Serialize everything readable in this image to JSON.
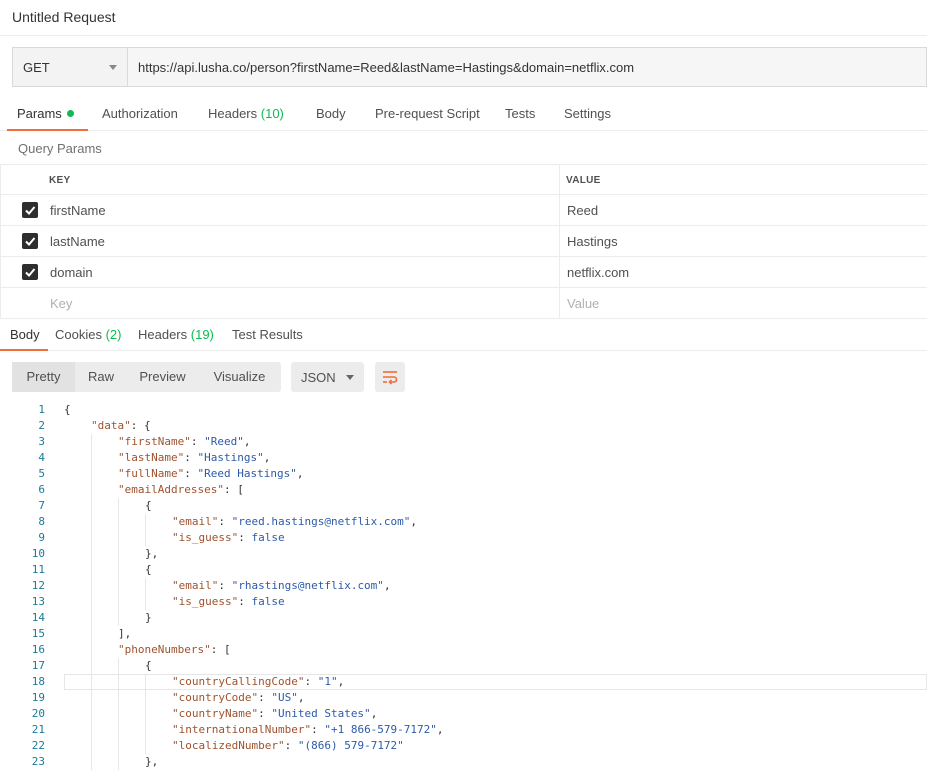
{
  "request": {
    "title": "Untitled Request",
    "method": "GET",
    "url": "https://api.lusha.co/person?firstName=Reed&lastName=Hastings&domain=netflix.com"
  },
  "request_tabs": [
    {
      "label": "Params",
      "count": "",
      "dot": true,
      "active": true
    },
    {
      "label": "Authorization",
      "count": "",
      "dot": false,
      "active": false
    },
    {
      "label": "Headers",
      "count": "(10)",
      "dot": false,
      "active": false
    },
    {
      "label": "Body",
      "count": "",
      "dot": false,
      "active": false
    },
    {
      "label": "Pre-request Script",
      "count": "",
      "dot": false,
      "active": false
    },
    {
      "label": "Tests",
      "count": "",
      "dot": false,
      "active": false
    },
    {
      "label": "Settings",
      "count": "",
      "dot": false,
      "active": false
    }
  ],
  "query_params": {
    "section_label": "Query Params",
    "key_header": "KEY",
    "value_header": "VALUE",
    "rows": [
      {
        "key": "firstName",
        "value": "Reed",
        "checked": true
      },
      {
        "key": "lastName",
        "value": "Hastings",
        "checked": true
      },
      {
        "key": "domain",
        "value": "netflix.com",
        "checked": true
      }
    ],
    "key_placeholder": "Key",
    "value_placeholder": "Value"
  },
  "response_tabs": [
    {
      "label": "Body",
      "count": "",
      "active": true
    },
    {
      "label": "Cookies",
      "count": "(2)",
      "active": false
    },
    {
      "label": "Headers",
      "count": "(19)",
      "active": false
    },
    {
      "label": "Test Results",
      "count": "",
      "active": false
    }
  ],
  "view_modes": [
    "Pretty",
    "Raw",
    "Preview",
    "Visualize"
  ],
  "active_view_mode": "Pretty",
  "format": "JSON",
  "colors": {
    "accent": "#f26b3a",
    "success": "#0cbb52",
    "link_blue": "#2e5aa8",
    "json_key": "#a0522d"
  },
  "code_lines": [
    {
      "n": "1",
      "indent": 0,
      "parts": [
        [
          "p",
          "{"
        ]
      ]
    },
    {
      "n": "2",
      "indent": 1,
      "parts": [
        [
          "k",
          "\"data\""
        ],
        [
          "p",
          ": {"
        ]
      ]
    },
    {
      "n": "3",
      "indent": 2,
      "parts": [
        [
          "k",
          "\"firstName\""
        ],
        [
          "p",
          ": "
        ],
        [
          "s",
          "\"Reed\""
        ],
        [
          "p",
          ","
        ]
      ]
    },
    {
      "n": "4",
      "indent": 2,
      "parts": [
        [
          "k",
          "\"lastName\""
        ],
        [
          "p",
          ": "
        ],
        [
          "s",
          "\"Hastings\""
        ],
        [
          "p",
          ","
        ]
      ]
    },
    {
      "n": "5",
      "indent": 2,
      "parts": [
        [
          "k",
          "\"fullName\""
        ],
        [
          "p",
          ": "
        ],
        [
          "s",
          "\"Reed Hastings\""
        ],
        [
          "p",
          ","
        ]
      ]
    },
    {
      "n": "6",
      "indent": 2,
      "parts": [
        [
          "k",
          "\"emailAddresses\""
        ],
        [
          "p",
          ": ["
        ]
      ]
    },
    {
      "n": "7",
      "indent": 3,
      "parts": [
        [
          "p",
          "{"
        ]
      ]
    },
    {
      "n": "8",
      "indent": 4,
      "parts": [
        [
          "k",
          "\"email\""
        ],
        [
          "p",
          ": "
        ],
        [
          "s",
          "\"reed.hastings@netflix.com\""
        ],
        [
          "p",
          ","
        ]
      ]
    },
    {
      "n": "9",
      "indent": 4,
      "parts": [
        [
          "k",
          "\"is_guess\""
        ],
        [
          "p",
          ": "
        ],
        [
          "s",
          "false"
        ]
      ]
    },
    {
      "n": "10",
      "indent": 3,
      "parts": [
        [
          "p",
          "},"
        ]
      ]
    },
    {
      "n": "11",
      "indent": 3,
      "parts": [
        [
          "p",
          "{"
        ]
      ]
    },
    {
      "n": "12",
      "indent": 4,
      "parts": [
        [
          "k",
          "\"email\""
        ],
        [
          "p",
          ": "
        ],
        [
          "s",
          "\"rhastings@netflix.com\""
        ],
        [
          "p",
          ","
        ]
      ]
    },
    {
      "n": "13",
      "indent": 4,
      "parts": [
        [
          "k",
          "\"is_guess\""
        ],
        [
          "p",
          ": "
        ],
        [
          "s",
          "false"
        ]
      ]
    },
    {
      "n": "14",
      "indent": 3,
      "parts": [
        [
          "p",
          "}"
        ]
      ]
    },
    {
      "n": "15",
      "indent": 2,
      "parts": [
        [
          "p",
          "],"
        ]
      ]
    },
    {
      "n": "16",
      "indent": 2,
      "parts": [
        [
          "k",
          "\"phoneNumbers\""
        ],
        [
          "p",
          ": ["
        ]
      ]
    },
    {
      "n": "17",
      "indent": 3,
      "parts": [
        [
          "p",
          "{"
        ]
      ]
    },
    {
      "n": "18",
      "indent": 4,
      "hl": true,
      "parts": [
        [
          "k",
          "\"countryCallingCode\""
        ],
        [
          "p",
          ": "
        ],
        [
          "s",
          "\"1\""
        ],
        [
          "p",
          ","
        ]
      ]
    },
    {
      "n": "19",
      "indent": 4,
      "parts": [
        [
          "k",
          "\"countryCode\""
        ],
        [
          "p",
          ": "
        ],
        [
          "s",
          "\"US\""
        ],
        [
          "p",
          ","
        ]
      ]
    },
    {
      "n": "20",
      "indent": 4,
      "parts": [
        [
          "k",
          "\"countryName\""
        ],
        [
          "p",
          ": "
        ],
        [
          "s",
          "\"United States\""
        ],
        [
          "p",
          ","
        ]
      ]
    },
    {
      "n": "21",
      "indent": 4,
      "parts": [
        [
          "k",
          "\"internationalNumber\""
        ],
        [
          "p",
          ": "
        ],
        [
          "s",
          "\"+1 866-579-7172\""
        ],
        [
          "p",
          ","
        ]
      ]
    },
    {
      "n": "22",
      "indent": 4,
      "parts": [
        [
          "k",
          "\"localizedNumber\""
        ],
        [
          "p",
          ": "
        ],
        [
          "s",
          "\"(866) 579-7172\""
        ]
      ]
    },
    {
      "n": "23",
      "indent": 3,
      "parts": [
        [
          "p",
          "},"
        ]
      ]
    }
  ]
}
